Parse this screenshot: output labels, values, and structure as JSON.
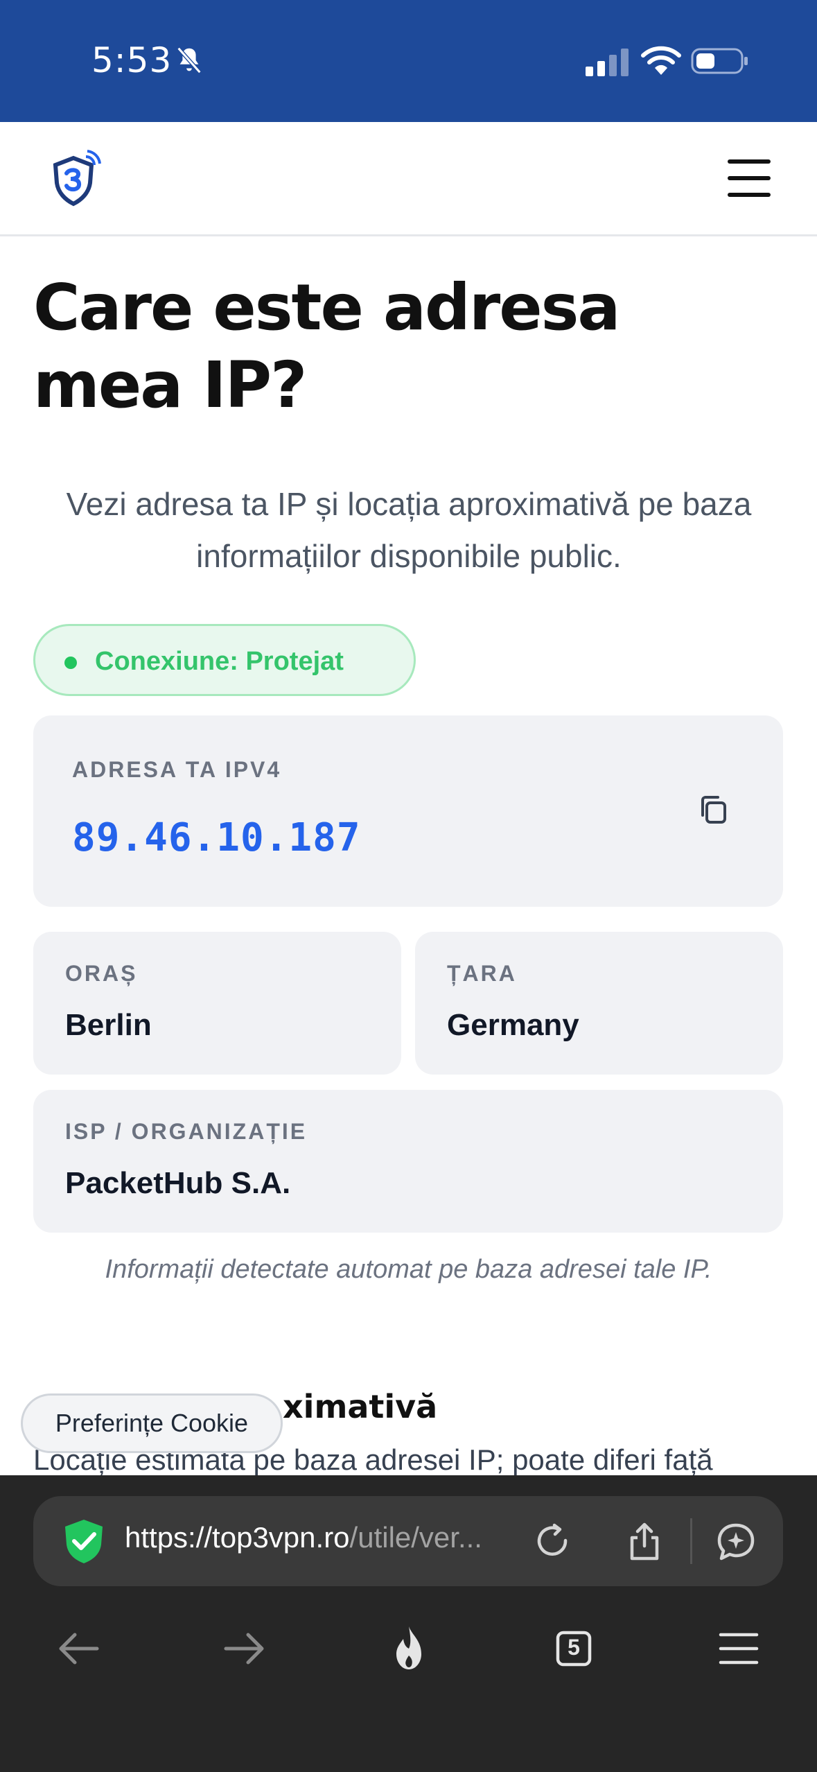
{
  "status_bar": {
    "time": "5:53"
  },
  "header": {
    "logo_text": "3"
  },
  "main": {
    "title": "Care este adresa mea IP?",
    "subtitle": "Vezi adresa ta IP și locația aproximativă pe baza informațiilor disponibile public.",
    "connection_status": "Conexiune: Protejat",
    "ip_card": {
      "label": "ADRESA TA IPV4",
      "value": "89.46.10.187"
    },
    "city": {
      "label": "ORAȘ",
      "value": "Berlin"
    },
    "country": {
      "label": "ȚARA",
      "value": "Germany"
    },
    "isp": {
      "label": "ISP / ORGANIZAȚIE",
      "value": "PacketHub S.A."
    },
    "note": "Informații detectate automat pe baza adresei tale IP.",
    "section_heading_partial": "ximativă",
    "section_text_partial": "Locație estimată pe baza adresei IP; poate diferi față"
  },
  "cookie_button": "Preferințe Cookie",
  "browser": {
    "url_host": "https://top3vpn.ro",
    "url_path": "/utile/ver...",
    "tab_count": "5"
  },
  "colors": {
    "status_bar_bg": "#1e4a9a",
    "accent_blue": "#2563eb",
    "protected_green": "#22c55e",
    "card_bg": "#f1f2f5"
  }
}
